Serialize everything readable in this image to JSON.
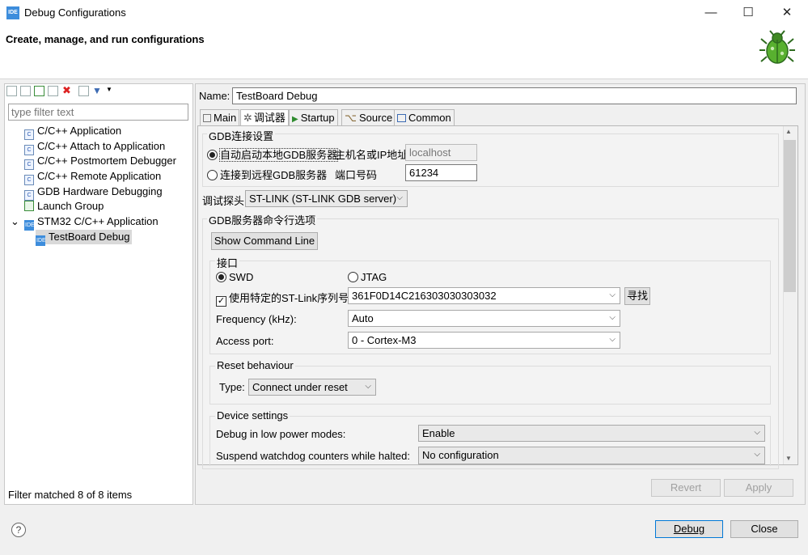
{
  "window": {
    "title": "Debug Configurations",
    "icon_text": "IDE",
    "min": "—",
    "max": "☐",
    "close": "✕"
  },
  "banner": {
    "title": "Create, manage, and run configurations"
  },
  "left": {
    "filter_placeholder": "type filter text",
    "tree": [
      {
        "label": "C/C++ Application",
        "icon": "C"
      },
      {
        "label": "C/C++ Attach to Application",
        "icon": "C"
      },
      {
        "label": "C/C++ Postmortem Debugger",
        "icon": "C"
      },
      {
        "label": "C/C++ Remote Application",
        "icon": "C"
      },
      {
        "label": "GDB Hardware Debugging",
        "icon": "C"
      },
      {
        "label": "Launch Group",
        "icon": ""
      },
      {
        "label": "STM32 C/C++ Application",
        "icon": "IDE"
      },
      {
        "label": "TestBoard Debug",
        "icon": "IDE"
      }
    ],
    "expander": "⌄",
    "status": "Filter matched 8 of 8 items"
  },
  "right": {
    "name_label": "Name:",
    "name_value": "TestBoard Debug",
    "tabs": [
      "Main",
      "调试器",
      "Startup",
      "Source",
      "Common"
    ],
    "gdb_group": "GDB连接设置",
    "radio_local": "自动启动本地GDB服务器",
    "host_label": "主机名或IP地址",
    "host_value": "localhost",
    "radio_remote": "连接到远程GDB服务器",
    "port_label": "端口号码",
    "port_value": "61234",
    "probe_label": "调试探头",
    "probe_value": "ST-LINK (ST-LINK GDB server)",
    "server_opts": "GDB服务器命令行选项",
    "show_cmd": "Show Command Line",
    "interface_group": "接口",
    "swd": "SWD",
    "jtag": "JTAG",
    "serial_check": "使用特定的ST-Link序列号",
    "serial_value": "361F0D14C216303030303032",
    "find_btn": "寻找",
    "freq_label": "Frequency (kHz):",
    "freq_value": "Auto",
    "port_access_label": "Access port:",
    "port_access_value": "0 - Cortex-M3",
    "reset_group": "Reset behaviour",
    "type_label": "Type:",
    "type_value": "Connect under reset",
    "device_group": "Device settings",
    "lowpower_label": "Debug in low power modes:",
    "lowpower_value": "Enable",
    "watchdog_label": "Suspend watchdog counters while halted:",
    "watchdog_value": "No configuration",
    "revert": "Revert",
    "apply": "Apply"
  },
  "footer": {
    "help": "?",
    "debug": "Debug",
    "close": "Close"
  }
}
